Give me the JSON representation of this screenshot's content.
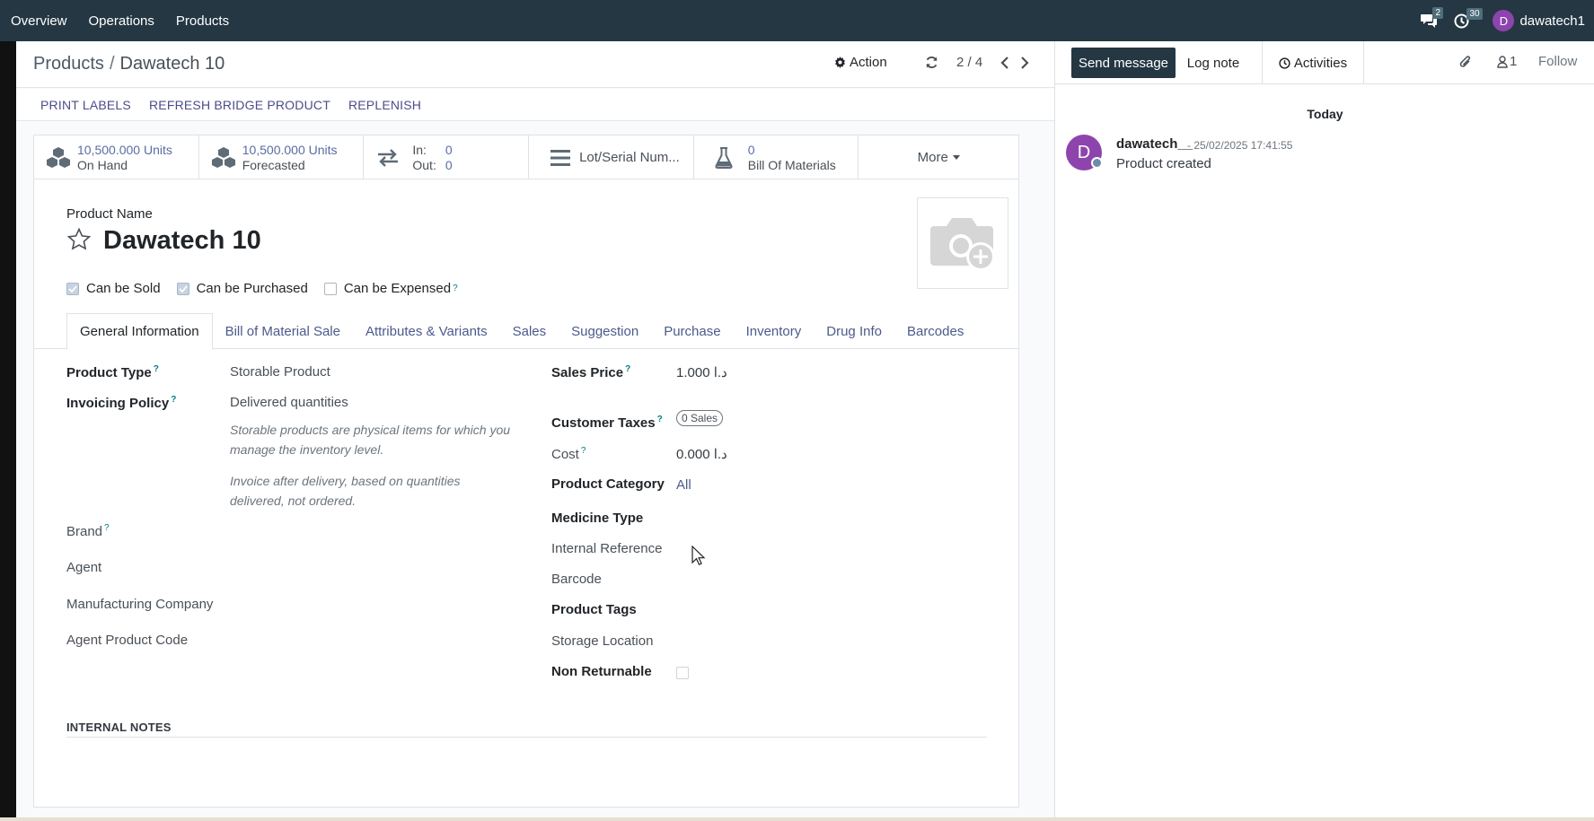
{
  "navbar": {
    "menu": [
      "Overview",
      "Operations",
      "Products"
    ],
    "messages_count": "2",
    "activities_count": "30",
    "user_initial": "D",
    "user_name": "dawatech1"
  },
  "control_panel": {
    "breadcrumb_parent": "Products",
    "breadcrumb_sep": "/",
    "breadcrumb_current": "Dawatech 10",
    "action_label": "Action",
    "pager_value": "2 / 4"
  },
  "buttons": [
    "PRINT LABELS",
    "REFRESH BRIDGE PRODUCT",
    "REPLENISH"
  ],
  "smart_buttons": {
    "onhand": {
      "value": "10,500.000 Units",
      "label": "On Hand"
    },
    "forecast": {
      "value": "10,500.000 Units",
      "label": "Forecasted"
    },
    "inout": {
      "in_label": "In:",
      "in_value": "0",
      "out_label": "Out:",
      "out_value": "0"
    },
    "lots": {
      "label": "Lot/Serial Num..."
    },
    "bom": {
      "value": "0",
      "label": "Bill Of Materials"
    },
    "more": "More"
  },
  "product": {
    "name_label": "Product Name",
    "name": "Dawatech 10",
    "checkboxes": [
      {
        "label": "Can be Sold",
        "checked": true
      },
      {
        "label": "Can be Purchased",
        "checked": true
      },
      {
        "label": "Can be Expensed",
        "checked": false
      }
    ]
  },
  "tabs": [
    "General Information",
    "Bill of Material Sale",
    "Attributes & Variants",
    "Sales",
    "Suggestion",
    "Purchase",
    "Inventory",
    "Drug Info",
    "Barcodes"
  ],
  "left_fields": {
    "product_type_label": "Product Type",
    "product_type_value": "Storable Product",
    "invoicing_label": "Invoicing Policy",
    "invoicing_value": "Delivered quantities",
    "desc1": "Storable products are physical items for which you manage the inventory level.",
    "desc2": "Invoice after delivery, based on quantities delivered, not ordered.",
    "brand_label": "Brand",
    "agent_label": "Agent",
    "manufacturer_label": "Manufacturing Company",
    "agent_code_label": "Agent Product Code"
  },
  "right_fields": {
    "sales_price_label": "Sales Price",
    "sales_price_value": "1.000  د.ا",
    "customer_taxes_label": "Customer Taxes",
    "customer_taxes_value": "0 Sales",
    "cost_label": "Cost",
    "cost_value": "0.000  د.ا",
    "category_label": "Product Category",
    "category_value": "All",
    "medicine_type_label": "Medicine Type",
    "internal_ref_label": "Internal Reference",
    "barcode_label": "Barcode",
    "tags_label": "Product Tags",
    "storage_label": "Storage Location",
    "non_returnable_label": "Non Returnable"
  },
  "notes": {
    "title": "INTERNAL NOTES"
  },
  "help_mark": "?",
  "chatter": {
    "send_message": "Send message",
    "log_note": "Log note",
    "activities": "Activities",
    "followers_count": "1",
    "follow": "Follow",
    "today": "Today",
    "message": {
      "author_initial": "D",
      "author": "dawatech__",
      "date": "- 25/02/2025 17:41:55",
      "body": "Product created"
    }
  },
  "colors": {
    "navbar": "#243743",
    "link": "#4c5a8c",
    "avatar": "#8e44ad"
  }
}
